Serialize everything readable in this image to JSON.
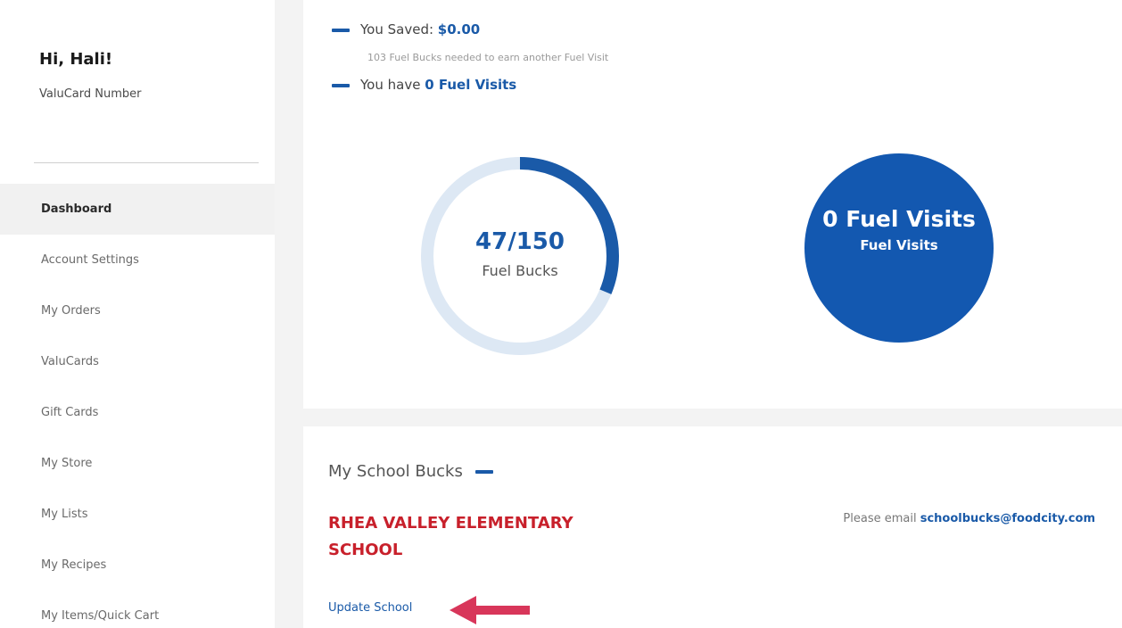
{
  "sidebar": {
    "greeting": "Hi, Hali!",
    "card_label": "ValuCard Number",
    "items": [
      {
        "label": "Dashboard",
        "active": true
      },
      {
        "label": "Account Settings"
      },
      {
        "label": "My Orders"
      },
      {
        "label": "ValuCards"
      },
      {
        "label": "Gift Cards"
      },
      {
        "label": "My Store"
      },
      {
        "label": "My Lists"
      },
      {
        "label": "My Recipes"
      },
      {
        "label": "My Items/Quick Cart"
      }
    ]
  },
  "fuel": {
    "saved_label": "You Saved: ",
    "saved_amount": "$0.00",
    "needed_text": "103 Fuel Bucks needed to earn another Fuel Visit",
    "visits_label": "You have ",
    "visits_amount": "0 Fuel Visits",
    "bucks_value": "47/150",
    "bucks_label": "Fuel Bucks",
    "bucks_progress": 0.313,
    "visit_circle_main": "0 Fuel Visits",
    "visit_circle_sub": "Fuel Visits"
  },
  "school": {
    "heading": "My School Bucks",
    "name": "RHEA VALLEY ELEMENTARY SCHOOL",
    "email_prefix": "Please email ",
    "email": "schoolbucks@foodcity.com",
    "update_label": "Update School"
  },
  "colors": {
    "accent": "#1a5aa8",
    "circle": "#1358b0",
    "ring_track": "#dde8f4",
    "school_red": "#c8202b",
    "arrow": "#d8365a"
  }
}
